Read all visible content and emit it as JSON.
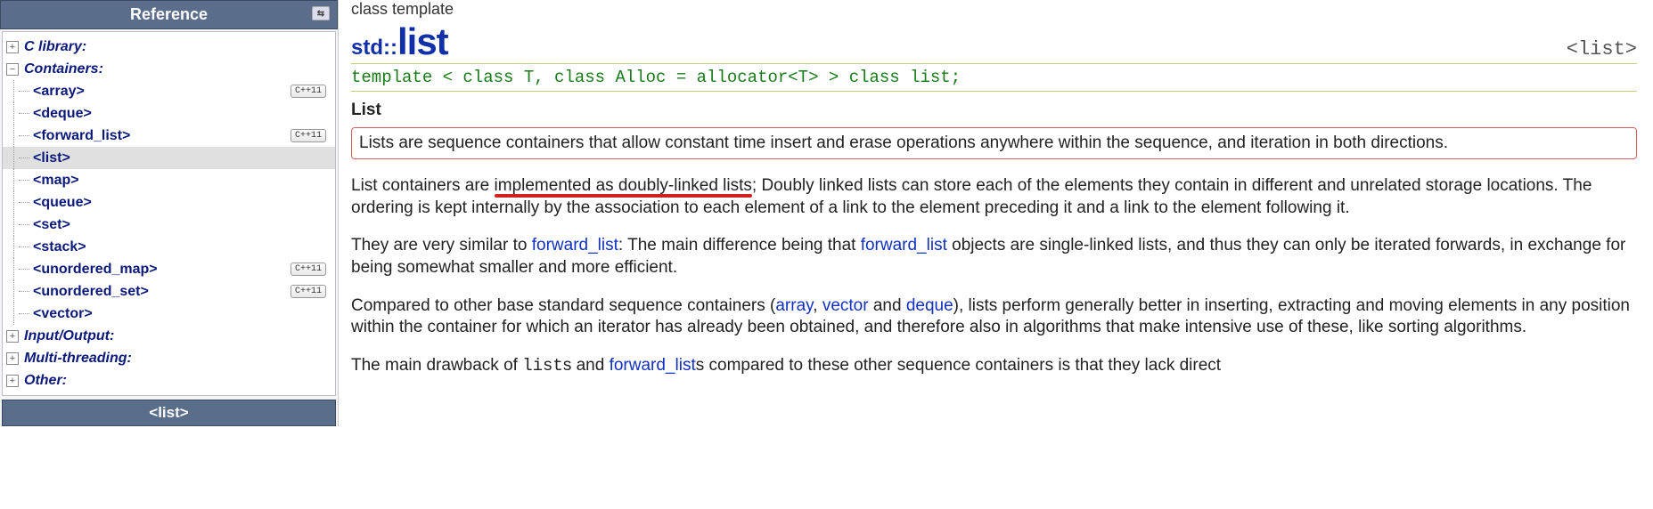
{
  "sidebar": {
    "header": "Reference",
    "top": [
      {
        "label": "C library:",
        "exp": "+"
      },
      {
        "label": "Containers:",
        "exp": "−"
      }
    ],
    "children": [
      {
        "label": "<array>",
        "cpp11": true
      },
      {
        "label": "<deque>"
      },
      {
        "label": "<forward_list>",
        "cpp11": true
      },
      {
        "label": "<list>",
        "selected": true
      },
      {
        "label": "<map>"
      },
      {
        "label": "<queue>"
      },
      {
        "label": "<set>"
      },
      {
        "label": "<stack>"
      },
      {
        "label": "<unordered_map>",
        "cpp11": true
      },
      {
        "label": "<unordered_set>",
        "cpp11": true
      },
      {
        "label": "<vector>"
      }
    ],
    "bottom": [
      {
        "label": "Input/Output:",
        "exp": "+"
      },
      {
        "label": "Multi-threading:",
        "exp": "+"
      },
      {
        "label": "Other:",
        "exp": "+"
      }
    ],
    "subheader": "<list>"
  },
  "content": {
    "superhead": "class template",
    "ns": "std::",
    "title": "list",
    "tag_right": "<list>",
    "template_sig": "template < class T, class Alloc = allocator<T> > class list;",
    "section_title": "List",
    "box_text": "Lists are sequence containers that allow constant time insert and erase operations anywhere within the sequence, and iteration in both directions.",
    "p2_pre": "List containers are ",
    "p2_u1": "implemented as doubly-linked lists",
    "p2_post": "; Doubly linked lists can store each of the elements they contain in different and unrelated storage locations. The ordering is kept internally by the association to each element of a link to the element preceding it and a link to the element following it.",
    "p3_a": "They are very similar to ",
    "fl": "forward_list",
    "p3_b": ": The main difference being that ",
    "p3_c": " objects are single-linked lists, and thus they can only be iterated forwards, in exchange for being somewhat smaller and more efficient.",
    "p4_a": "Compared to other base standard sequence containers (",
    "arr": "array",
    "vec": "vector",
    "deq": "deque",
    "comma": ", ",
    "and": " and ",
    "p4_b": "), lists perform generally better in inserting, extracting and moving elements in any position within the container for which an iterator has already been obtained, and therefore also in algorithms that make intensive use of these, like sorting algorithms.",
    "p5_a": "The main drawback of ",
    "listword": "list",
    "p5_b": "s and ",
    "p5_c": "s compared to these other sequence containers is that they lack direct",
    "cpp11_badge": "C++11"
  }
}
